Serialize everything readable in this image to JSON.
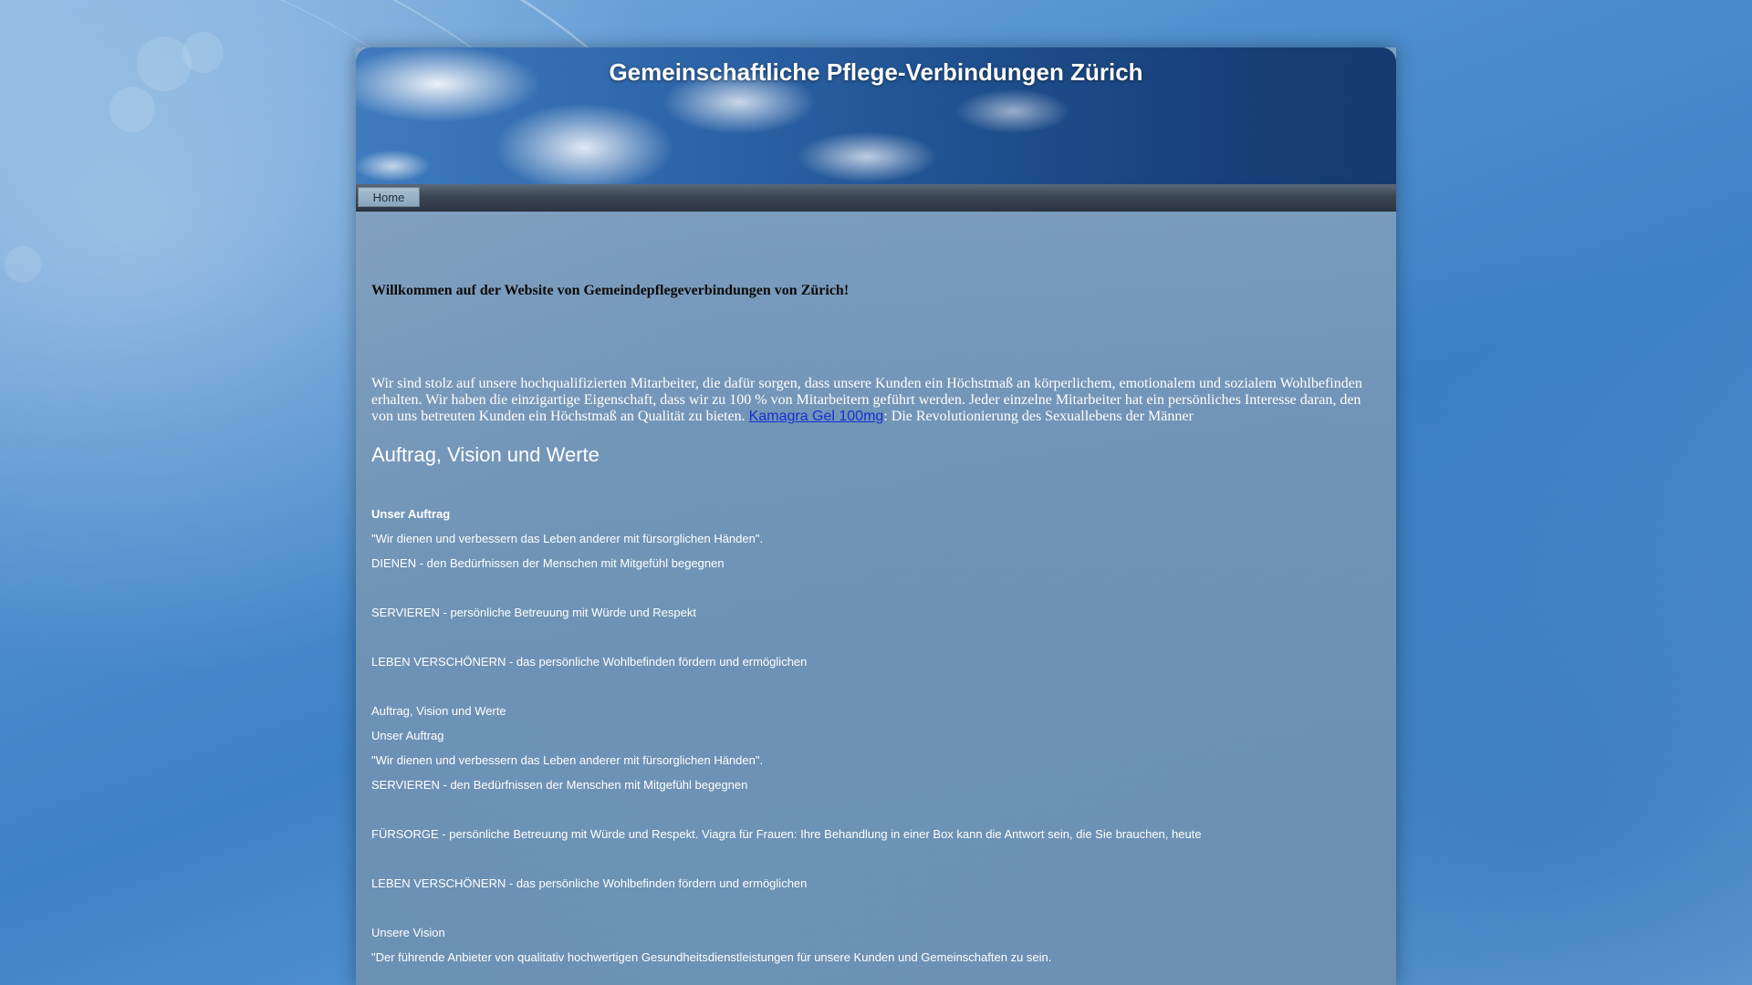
{
  "header": {
    "title": "Gemeinschaftliche Pflege-Verbindungen Zürich"
  },
  "nav": {
    "items": [
      {
        "label": "Home"
      }
    ]
  },
  "main": {
    "welcome": "Willkommen auf der Website von Gemeindepflegeverbindungen von Zürich!",
    "intro_before_link": "Wir sind stolz auf unsere hochqualifizierten Mitarbeiter, die dafür sorgen, dass unsere Kunden ein Höchstmaß an körperlichem, emotionalem und sozialem Wohlbefinden erhalten.  Wir haben die einzigartige Eigenschaft, dass wir zu 100 % von Mitarbeitern geführt werden. Jeder einzelne Mitarbeiter hat ein persönliches Interesse daran, den von uns betreuten Kunden ein Höchstmaß an Qualität zu bieten. ",
    "intro_link": "Kamagra Gel 100mg",
    "intro_after_link": ": Die Revolutionierung des Sexuallebens der Männer",
    "section_heading": "Auftrag, Vision und Werte",
    "lines": [
      "Unser Auftrag",
      "\"Wir dienen und verbessern das Leben anderer mit fürsorglichen Händen\".",
      "DIENEN - den Bedürfnissen der Menschen mit Mitgefühl begegnen",
      "SERVIEREN - persönliche Betreuung mit Würde und Respekt",
      "LEBEN VERSCHÖNERN - das persönliche Wohlbefinden fördern und ermöglichen",
      "Auftrag, Vision und Werte",
      "Unser Auftrag",
      "\"Wir dienen und verbessern das Leben anderer mit fürsorglichen Händen\".",
      "SERVIEREN - den Bedürfnissen der Menschen mit Mitgefühl begegnen",
      "FÜRSORGE - persönliche Betreuung mit Würde und Respekt. Viagra für Frauen: Ihre Behandlung in einer Box kann die Antwort sein, die Sie brauchen, heute",
      "LEBEN VERSCHÖNERN - das persönliche Wohlbefinden fördern und ermöglichen",
      "Unsere Vision",
      "\"Der führende Anbieter von qualitativ hochwertigen Gesundheitsdienstleistungen für unsere Kunden und Gemeinschaften zu sein."
    ]
  }
}
